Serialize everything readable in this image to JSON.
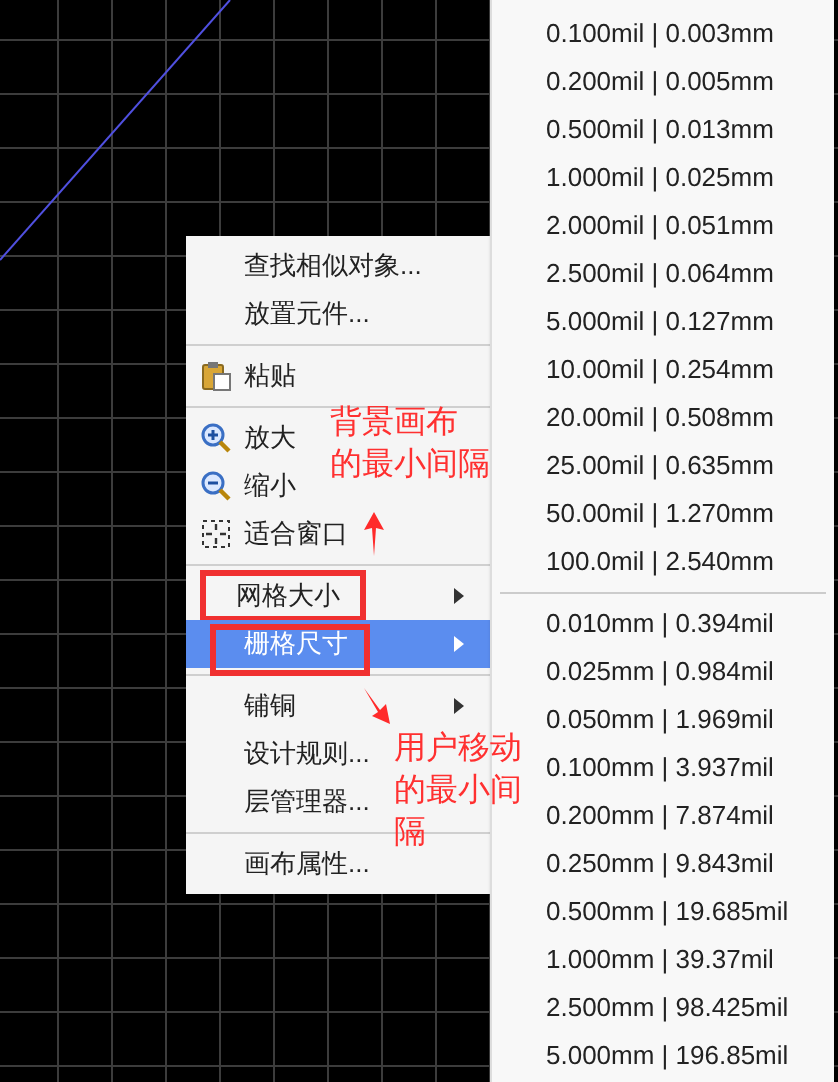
{
  "context_menu": {
    "items": [
      {
        "kind": "plain",
        "label": "查找相似对象...",
        "selected": false,
        "outlined": false
      },
      {
        "kind": "plain",
        "label": "放置元件...",
        "selected": false,
        "outlined": false
      },
      {
        "kind": "separator"
      },
      {
        "kind": "paste",
        "label": "粘贴",
        "selected": false,
        "outlined": false
      },
      {
        "kind": "separator"
      },
      {
        "kind": "zoom-in",
        "label": "放大",
        "selected": false,
        "outlined": false
      },
      {
        "kind": "zoom-out",
        "label": "缩小",
        "selected": false,
        "outlined": false
      },
      {
        "kind": "fit",
        "label": "适合窗口",
        "selected": false,
        "outlined": false
      },
      {
        "kind": "separator"
      },
      {
        "kind": "submenu",
        "label": "网格大小",
        "selected": false,
        "outlined": true
      },
      {
        "kind": "submenu",
        "label": "栅格尺寸",
        "selected": true,
        "outlined": true
      },
      {
        "kind": "separator"
      },
      {
        "kind": "submenu",
        "label": "铺铜",
        "selected": false,
        "outlined": false
      },
      {
        "kind": "plain",
        "label": "设计规则...",
        "selected": false,
        "outlined": false
      },
      {
        "kind": "plain",
        "label": "层管理器...",
        "selected": false,
        "outlined": false
      },
      {
        "kind": "separator"
      },
      {
        "kind": "plain",
        "label": "画布属性...",
        "selected": false,
        "outlined": false
      }
    ]
  },
  "submenu": {
    "groups": [
      {
        "items": [
          "0.100mil | 0.003mm",
          "0.200mil | 0.005mm",
          "0.500mil | 0.013mm",
          "1.000mil | 0.025mm",
          "2.000mil | 0.051mm",
          "2.500mil | 0.064mm",
          "5.000mil | 0.127mm",
          "10.00mil | 0.254mm",
          "20.00mil | 0.508mm",
          "25.00mil | 0.635mm",
          "50.00mil | 1.270mm",
          "100.0mil | 2.540mm"
        ]
      },
      {
        "items": [
          "0.010mm | 0.394mil",
          "0.025mm | 0.984mil",
          "0.050mm | 1.969mil",
          "0.100mm | 3.937mil",
          "0.200mm | 7.874mil",
          "0.250mm | 9.843mil",
          "0.500mm | 19.685mil",
          "1.000mm | 39.37mil",
          "2.500mm | 98.425mil",
          "5.000mm | 196.85mil"
        ]
      }
    ]
  },
  "annotations": [
    {
      "lines": [
        "背景画布",
        "的最小间隔"
      ]
    },
    {
      "lines": [
        "用户移动",
        "的最小间",
        "隔"
      ]
    }
  ]
}
